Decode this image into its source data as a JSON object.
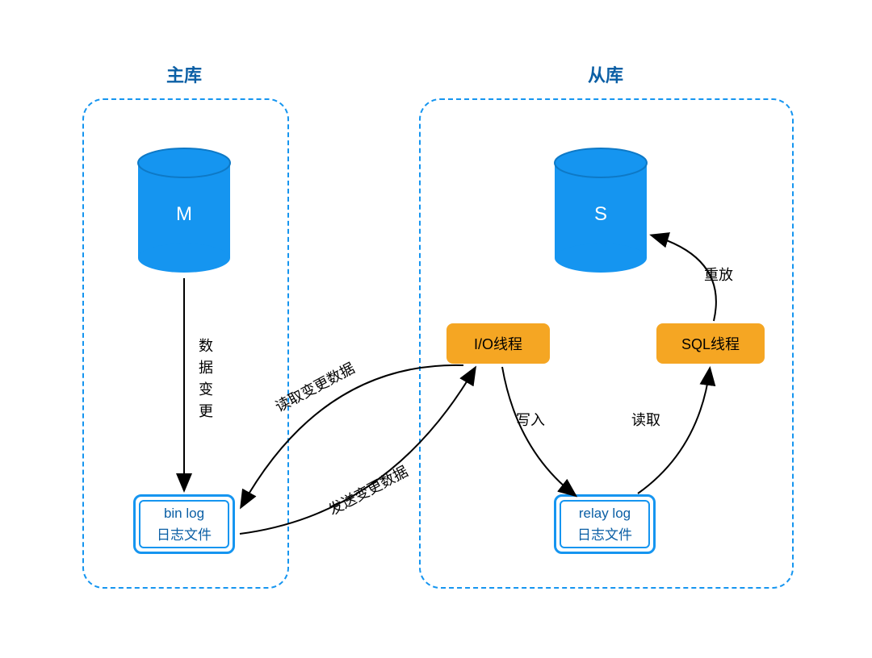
{
  "titles": {
    "master": "主库",
    "slave": "从库"
  },
  "nodes": {
    "master_db": "M",
    "slave_db": "S",
    "binlog_line1": "bin log",
    "binlog_line2": "日志文件",
    "relaylog_line1": "relay log",
    "relaylog_line2": "日志文件",
    "io_thread": "I/O线程",
    "sql_thread": "SQL线程"
  },
  "edges": {
    "data_change_1": "数",
    "data_change_2": "据",
    "data_change_3": "变",
    "data_change_4": "更",
    "read_changes": "读取变更数据",
    "send_changes": "发送变更数据",
    "write": "写入",
    "read": "读取",
    "replay": "重放"
  },
  "colors": {
    "accent_blue": "#1595f0",
    "header_blue": "#0b5fa5",
    "thread_orange": "#f5a623"
  }
}
